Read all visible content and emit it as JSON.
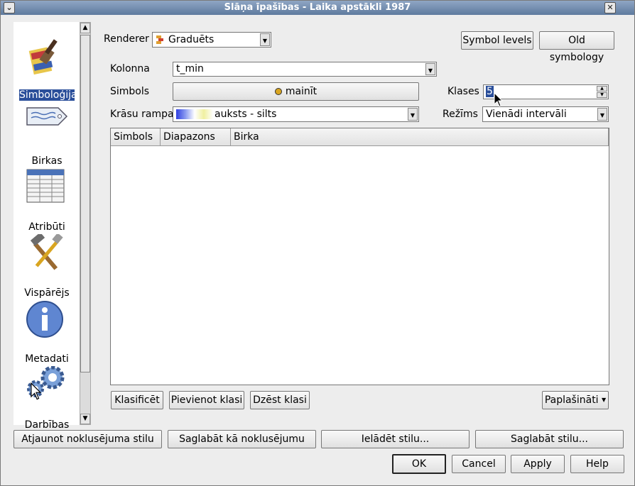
{
  "window": {
    "title": "Slāņa īpašības - Laika apstākli 1987"
  },
  "sidebar": {
    "items": [
      {
        "label": "Simboloģija",
        "icon": "paintbrush-icon"
      },
      {
        "label": "Birkas",
        "icon": "tag-icon"
      },
      {
        "label": "Atribūti",
        "icon": "table-icon"
      },
      {
        "label": "Vispārējs",
        "icon": "tools-icon"
      },
      {
        "label": "Metadati",
        "icon": "info-icon"
      },
      {
        "label": "Darbības",
        "icon": "gears-icon"
      }
    ]
  },
  "symbology": {
    "renderer_label": "Renderer",
    "renderer_value": "Graduēts",
    "symbol_levels": "Symbol levels",
    "old_symbology": "Old symbology",
    "column_label": "Kolonna",
    "column_value": "t_min",
    "symbol_label": "Simbols",
    "symbol_button": "mainīt",
    "classes_label": "Klases",
    "classes_value": "5",
    "ramp_label": "Krāsu rampa",
    "ramp_value": "auksts - silts",
    "mode_label": "Režīms",
    "mode_value": "Vienādi intervāli",
    "table_headers": [
      "Simbols",
      "Diapazons",
      "Birka"
    ],
    "classify": "Klasificēt",
    "add_class": "Pievienot klasi",
    "delete_class": "Dzēst klasi",
    "advanced": "Paplašināti"
  },
  "footer": {
    "restore_default": "Atjaunot noklusējuma stilu",
    "save_default": "Saglabāt kā noklusējumu",
    "load_style": "Ielādēt stilu...",
    "save_style": "Saglabāt stilu...",
    "ok": "OK",
    "cancel": "Cancel",
    "apply": "Apply",
    "help": "Help"
  },
  "colors": {
    "selection": "#2a4e9a",
    "titlebar": "#6f89ad"
  }
}
